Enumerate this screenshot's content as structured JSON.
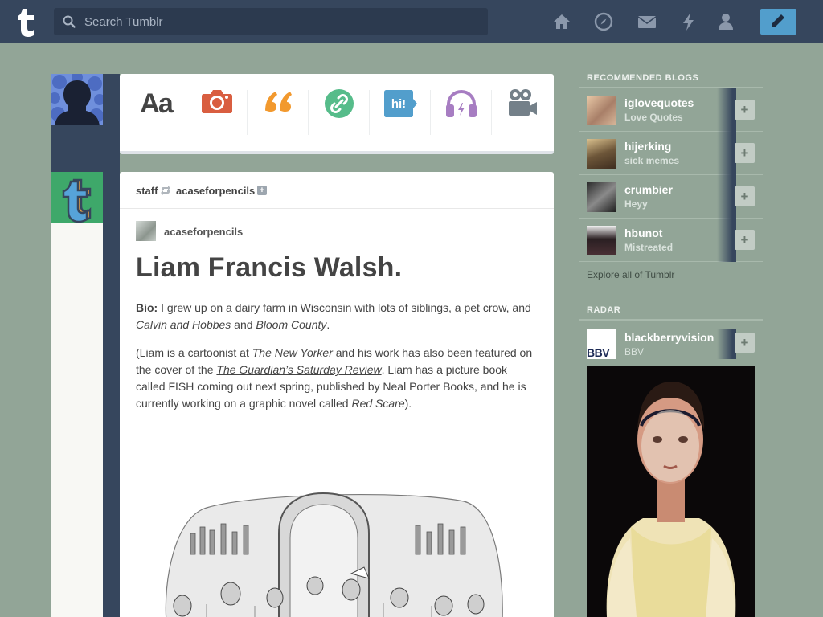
{
  "topbar": {
    "search_placeholder": "Search Tumblr",
    "nav_icons": [
      "home-icon",
      "explore-compass-icon",
      "inbox-mail-icon",
      "activity-lightning-icon",
      "account-person-icon"
    ],
    "compose_icon": "pencil-icon",
    "colors": {
      "bar": "#36465d",
      "compose": "#529ecc"
    }
  },
  "post_types": [
    {
      "name": "text",
      "glyph": "Aa",
      "color": "#444444"
    },
    {
      "name": "photo",
      "icon": "camera-icon",
      "color": "#d95e40"
    },
    {
      "name": "quote",
      "glyph": "66",
      "color": "#f2992e"
    },
    {
      "name": "link",
      "icon": "link-icon",
      "color": "#56bc8a"
    },
    {
      "name": "chat",
      "glyph": "hi!",
      "color": "#529ecc"
    },
    {
      "name": "audio",
      "icon": "headphones-icon",
      "color": "#a77dc2"
    },
    {
      "name": "video",
      "icon": "video-camera-icon",
      "color": "#748089"
    }
  ],
  "post": {
    "reblogger": "staff",
    "reblogged_from": "acaseforpencils",
    "source_blog": "acaseforpencils",
    "title": "Liam Francis Walsh.",
    "bio_label": "Bio:",
    "bio_text_1": " I grew up on a dairy farm in Wisconsin with lots of siblings, a pet crow, and ",
    "bio_italic_1": "Calvin and Hobbes",
    "bio_text_2": " and ",
    "bio_italic_2": "Bloom County",
    "bio_text_3": ".",
    "p2_text_1": "(Liam is a cartoonist at ",
    "p2_italic_1": "The New Yorker",
    "p2_text_2": " and his work has also been featured on the cover of the ",
    "p2_link": "The Guardian’s Saturday Review",
    "p2_text_3": ". Liam has a picture book called FISH coming out next spring, published by Neal Porter Books, and he is currently working on a graphic novel called ",
    "p2_italic_2": "Red Scare",
    "p2_text_4": ")."
  },
  "sidebar": {
    "recommended_heading": "RECOMMENDED BLOGS",
    "recommended": [
      {
        "name": "iglovequotes",
        "subtitle": "Love Quotes"
      },
      {
        "name": "hijerking",
        "subtitle": "sick memes"
      },
      {
        "name": "crumbier",
        "subtitle": "Heyy"
      },
      {
        "name": "hbunot",
        "subtitle": "Mistreated"
      }
    ],
    "explore_link": "Explore all of Tumblr",
    "radar_heading": "RADAR",
    "radar": {
      "name": "blackberryvision",
      "subtitle": "BBV",
      "logo_text": "BBV"
    }
  }
}
